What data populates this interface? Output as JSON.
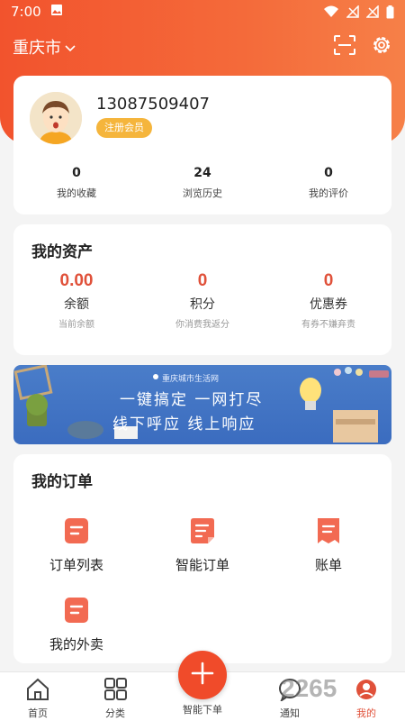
{
  "status_bar": {
    "time": "7:00"
  },
  "header": {
    "city": "重庆市"
  },
  "profile": {
    "phone": "13087509407",
    "member_badge": "注册会员",
    "stats": [
      {
        "value": "0",
        "label": "我的收藏"
      },
      {
        "value": "24",
        "label": "浏览历史"
      },
      {
        "value": "0",
        "label": "我的评价"
      }
    ]
  },
  "assets": {
    "title": "我的资产",
    "items": [
      {
        "value": "0.00",
        "name": "余额",
        "desc": "当前余额"
      },
      {
        "value": "0",
        "name": "积分",
        "desc": "你消费我返分"
      },
      {
        "value": "0",
        "name": "优惠券",
        "desc": "有券不嫌弃责"
      }
    ]
  },
  "banner": {
    "small": "重庆城市生活网",
    "line1": "一键搞定  一网打尽",
    "line2": "线下呼应  线上响应"
  },
  "orders": {
    "title": "我的订单",
    "items": [
      {
        "label": "订单列表"
      },
      {
        "label": "智能订单"
      },
      {
        "label": "账单"
      },
      {
        "label": "我的外卖"
      }
    ]
  },
  "nav": {
    "items": [
      {
        "label": "首页"
      },
      {
        "label": "分类"
      },
      {
        "label": "智能下单"
      },
      {
        "label": "通知"
      },
      {
        "label": "我的"
      }
    ]
  },
  "watermark": "2265",
  "colors": {
    "accent": "#f04b2a",
    "value_red": "#e0513a",
    "badge": "#f5b53c"
  }
}
